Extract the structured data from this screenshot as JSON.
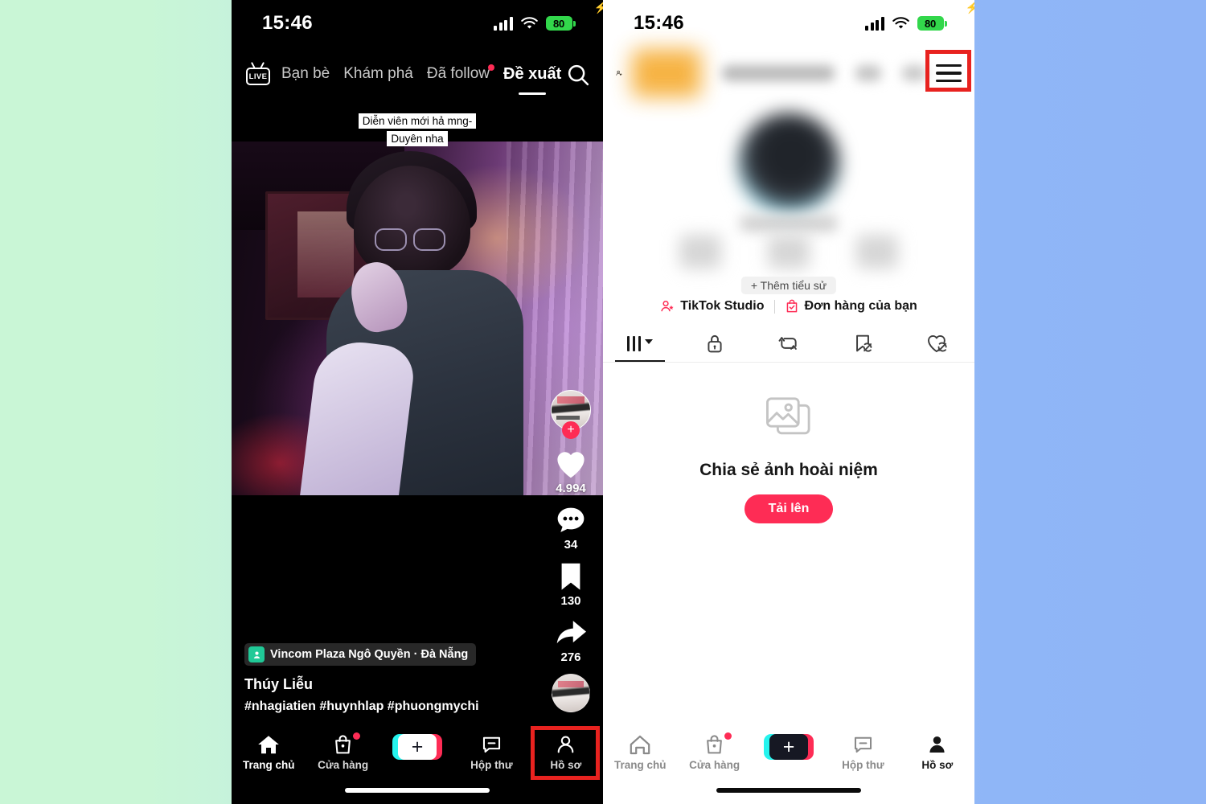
{
  "background": {
    "left_color": "#c9f6d6",
    "right_color": "#8fb4f6"
  },
  "accent": {
    "tiktok_red": "#fe2c55",
    "tiktok_cyan": "#25f4ee",
    "highlight_red": "#e8221f",
    "battery_green": "#32d74b"
  },
  "left_phone": {
    "status_bar": {
      "time": "15:46",
      "battery_percent": "80",
      "signal_icon": "cellular-signal-icon",
      "wifi_icon": "wifi-icon",
      "battery_icon": "battery-icon",
      "charging_icon": "charging-bolt-icon"
    },
    "top_nav": {
      "live_label": "LIVE",
      "tabs": [
        {
          "label": "Bạn bè",
          "active": false,
          "badge": false
        },
        {
          "label": "Khám phá",
          "active": false,
          "badge": false
        },
        {
          "label": "Đã follow",
          "active": false,
          "badge": true
        },
        {
          "label": "Đề xuất",
          "active": true,
          "badge": false
        }
      ],
      "search_icon": "search-icon"
    },
    "video": {
      "sticker_text": "Diễn viên mới hả mng-Duyên nha",
      "location": "Vincom Plaza Ngô Quyền · Đà Nẵng",
      "author": "Thúy Liễu",
      "hashtags": "#nhagiatien #huynhlap #phuongmychi"
    },
    "action_rail": {
      "follow_plus": "+",
      "like_count": "4.994",
      "comment_count": "34",
      "bookmark_count": "130",
      "share_count": "276"
    },
    "bottom_nav": [
      {
        "label": "Trang chủ",
        "icon": "home-icon",
        "active": true,
        "badge": false
      },
      {
        "label": "Cửa hàng",
        "icon": "shop-bag-icon",
        "active": false,
        "badge": true
      },
      {
        "label": "",
        "icon": "create-plus-icon",
        "active": false,
        "badge": false
      },
      {
        "label": "Hộp thư",
        "icon": "inbox-icon",
        "active": false,
        "badge": false
      },
      {
        "label": "Hồ sơ",
        "icon": "profile-person-icon",
        "active": false,
        "badge": false
      }
    ]
  },
  "right_phone": {
    "status_bar": {
      "time": "15:46",
      "battery_percent": "80"
    },
    "header": {
      "add_friend_icon": "add-person-icon",
      "menu_icon": "hamburger-menu-icon"
    },
    "profile": {
      "add_bio_label": "+ Thêm tiểu sử",
      "studio_label": "TikTok Studio",
      "orders_label": "Đơn hàng của bạn"
    },
    "content_tabs": [
      {
        "icon": "grid-videos-icon",
        "active": true
      },
      {
        "icon": "lock-private-icon",
        "active": false
      },
      {
        "icon": "repost-icon",
        "active": false
      },
      {
        "icon": "saved-hidden-icon",
        "active": false
      },
      {
        "icon": "liked-hidden-icon",
        "active": false
      }
    ],
    "empty_state": {
      "icon": "photo-stack-icon",
      "title": "Chia sẻ ảnh hoài niệm",
      "button_label": "Tải lên"
    },
    "bottom_nav": [
      {
        "label": "Trang chủ",
        "icon": "home-icon",
        "active": false,
        "badge": false
      },
      {
        "label": "Cửa hàng",
        "icon": "shop-bag-icon",
        "active": false,
        "badge": true
      },
      {
        "label": "",
        "icon": "create-plus-icon",
        "active": false,
        "badge": false
      },
      {
        "label": "Hộp thư",
        "icon": "inbox-icon",
        "active": false,
        "badge": false
      },
      {
        "label": "Hồ sơ",
        "icon": "profile-person-icon",
        "active": true,
        "badge": false
      }
    ]
  }
}
